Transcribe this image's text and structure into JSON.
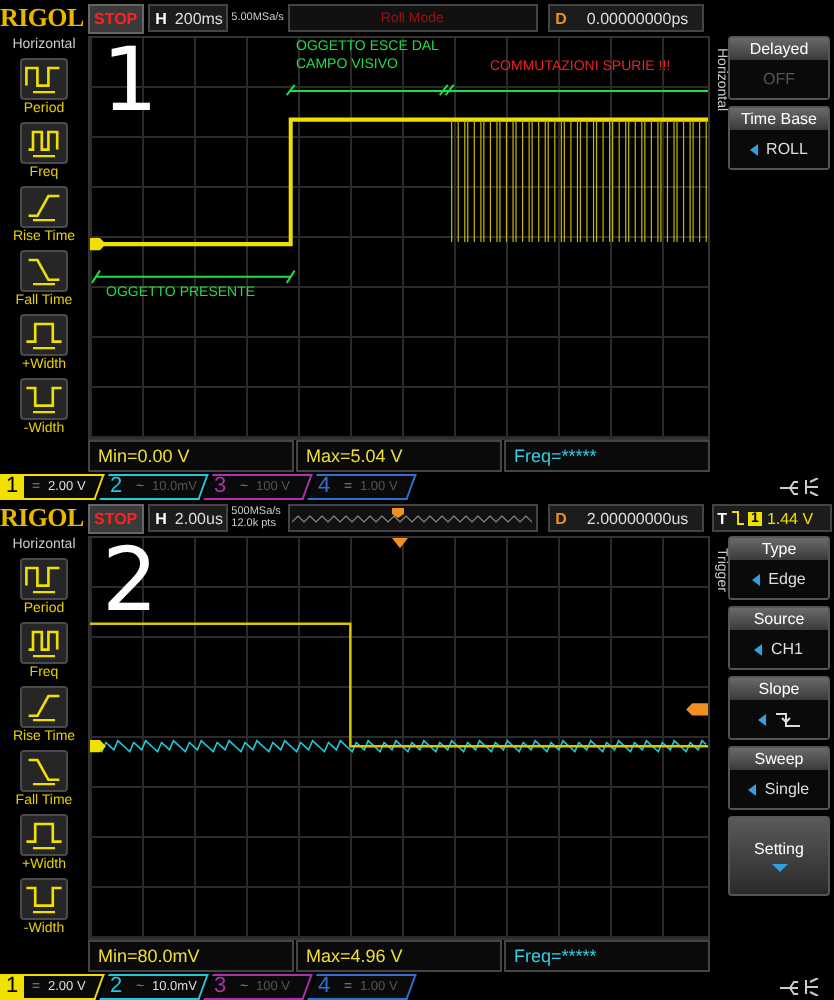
{
  "scopes": [
    {
      "label": "1",
      "brand": "RIGOL",
      "run_state": "STOP",
      "horizontal": {
        "key": "H",
        "timebase": "200ms"
      },
      "sample_info": [
        "5.00MSa/s"
      ],
      "center": {
        "kind": "mode",
        "text": "Roll Mode"
      },
      "delay": {
        "key": "D",
        "value": "0.00000000ps"
      },
      "waveform": {
        "kind": "roll"
      },
      "sidebar": {
        "title": "Horizontal",
        "items": [
          {
            "kind": "period",
            "label": "Period"
          },
          {
            "kind": "freq",
            "label": "Freq"
          },
          {
            "kind": "rise",
            "label": "Rise Time"
          },
          {
            "kind": "fall",
            "label": "Fall Time"
          },
          {
            "kind": "pwidth",
            "label": "+Width"
          },
          {
            "kind": "nwidth",
            "label": "-Width"
          }
        ]
      },
      "annotations": [
        {
          "lines": [
            "OGGETTO ESCE DAL",
            "CAMPO VISIVO"
          ],
          "color": "#22dd44"
        },
        {
          "lines": [
            "COMMUTAZIONI SPURIE !!!"
          ],
          "color": "#ee2222"
        },
        {
          "lines": [
            "OGGETTO PRESENTE"
          ],
          "color": "#22dd44"
        }
      ],
      "menu": {
        "title": "Horizontal",
        "items": [
          {
            "kind": "toggle",
            "label": "Delayed",
            "value": "OFF",
            "disabled": true
          },
          {
            "kind": "select",
            "label": "Time Base",
            "value": "ROLL",
            "disabled": false
          }
        ]
      },
      "measurements": [
        {
          "text": "Min=0.00 V",
          "color": "#f0e030"
        },
        {
          "text": "Max=5.04 V",
          "color": "#f0e030"
        },
        {
          "text": "Freq=*****",
          "color": "#30d0e8"
        }
      ],
      "channels": [
        {
          "number": "1",
          "coupling": "=",
          "scale": "2.00 V",
          "color": "#f0e000",
          "on": true,
          "selected": true
        },
        {
          "number": "2",
          "coupling": "~",
          "scale": "10.0mV",
          "color": "#20c8d8",
          "on": false,
          "selected": false
        },
        {
          "number": "3",
          "coupling": "~",
          "scale": "100 V",
          "color": "#b030b0",
          "on": false,
          "selected": false
        },
        {
          "number": "4",
          "coupling": "=",
          "scale": "1.00 V",
          "color": "#3070d0",
          "on": false,
          "selected": false
        }
      ]
    },
    {
      "label": "2",
      "brand": "RIGOL",
      "run_state": "STOP",
      "horizontal": {
        "key": "H",
        "timebase": "2.00us"
      },
      "sample_info": [
        "500MSa/s",
        "12.0k pts"
      ],
      "center": {
        "kind": "strip"
      },
      "delay": {
        "key": "D",
        "value": "2.00000000us"
      },
      "trigger": {
        "key": "T",
        "source": "1",
        "level": "1.44 V"
      },
      "waveform": {
        "kind": "single"
      },
      "sidebar": {
        "title": "Horizontal",
        "items": [
          {
            "kind": "period",
            "label": "Period"
          },
          {
            "kind": "freq",
            "label": "Freq"
          },
          {
            "kind": "rise",
            "label": "Rise Time"
          },
          {
            "kind": "fall",
            "label": "Fall Time"
          },
          {
            "kind": "pwidth",
            "label": "+Width"
          },
          {
            "kind": "nwidth",
            "label": "-Width"
          }
        ]
      },
      "menu": {
        "title": "Trigger",
        "items": [
          {
            "kind": "select",
            "label": "Type",
            "value": "Edge",
            "disabled": false
          },
          {
            "kind": "select",
            "label": "Source",
            "value": "CH1",
            "disabled": false
          },
          {
            "kind": "slope",
            "label": "Slope",
            "disabled": false
          },
          {
            "kind": "select",
            "label": "Sweep",
            "value": "Single",
            "disabled": false
          },
          {
            "kind": "submenu",
            "label": "Setting",
            "disabled": false
          }
        ]
      },
      "measurements": [
        {
          "text": "Min=80.0mV",
          "color": "#f0e030"
        },
        {
          "text": "Max=4.96 V",
          "color": "#f0e030"
        },
        {
          "text": "Freq=*****",
          "color": "#30d0e8"
        }
      ],
      "channels": [
        {
          "number": "1",
          "coupling": "=",
          "scale": "2.00 V",
          "color": "#f0e000",
          "on": true,
          "selected": true
        },
        {
          "number": "2",
          "coupling": "~",
          "scale": "10.0mV",
          "color": "#20c8d8",
          "on": true,
          "selected": false
        },
        {
          "number": "3",
          "coupling": "~",
          "scale": "100 V",
          "color": "#b030b0",
          "on": false,
          "selected": false
        },
        {
          "number": "4",
          "coupling": "=",
          "scale": "1.00 V",
          "color": "#3070d0",
          "on": false,
          "selected": false
        }
      ]
    }
  ]
}
